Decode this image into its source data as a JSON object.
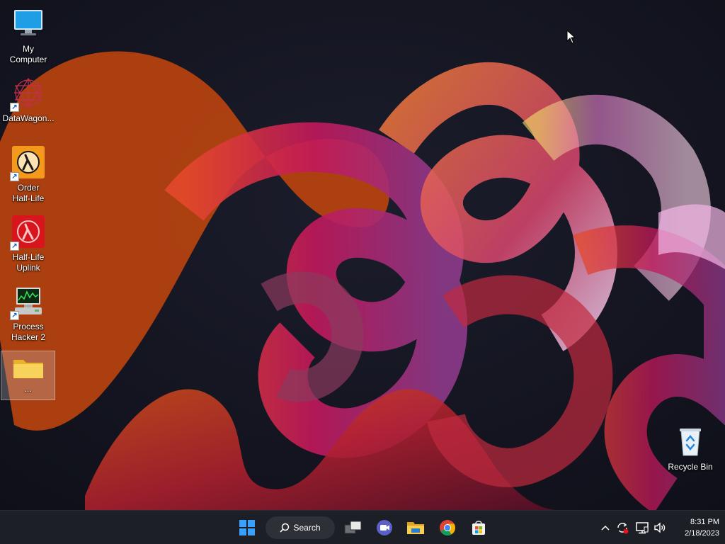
{
  "desktop": {
    "icons": [
      {
        "label": "My Computer"
      },
      {
        "label": "DataWagon..."
      },
      {
        "label": "Order\nHalf-Life"
      },
      {
        "label": "Half-Life\nUplink"
      },
      {
        "label": "Process\nHacker 2"
      },
      {
        "label": "..."
      }
    ],
    "recycle_bin": {
      "label": "Recycle Bin"
    }
  },
  "taskbar": {
    "search_label": "Search",
    "apps": [
      "windows-start-icon",
      "task-view-icon",
      "meet-icon",
      "file-explorer-icon",
      "chrome-icon",
      "store-icon"
    ],
    "tray": [
      "chevron-up-icon",
      "sync-icon",
      "network-icon",
      "volume-icon"
    ],
    "clock": {
      "time": "8:31 PM",
      "date": "2/18/2023"
    }
  },
  "colors": {
    "taskbar": "#1d1f26",
    "accent": "#0078d4"
  }
}
